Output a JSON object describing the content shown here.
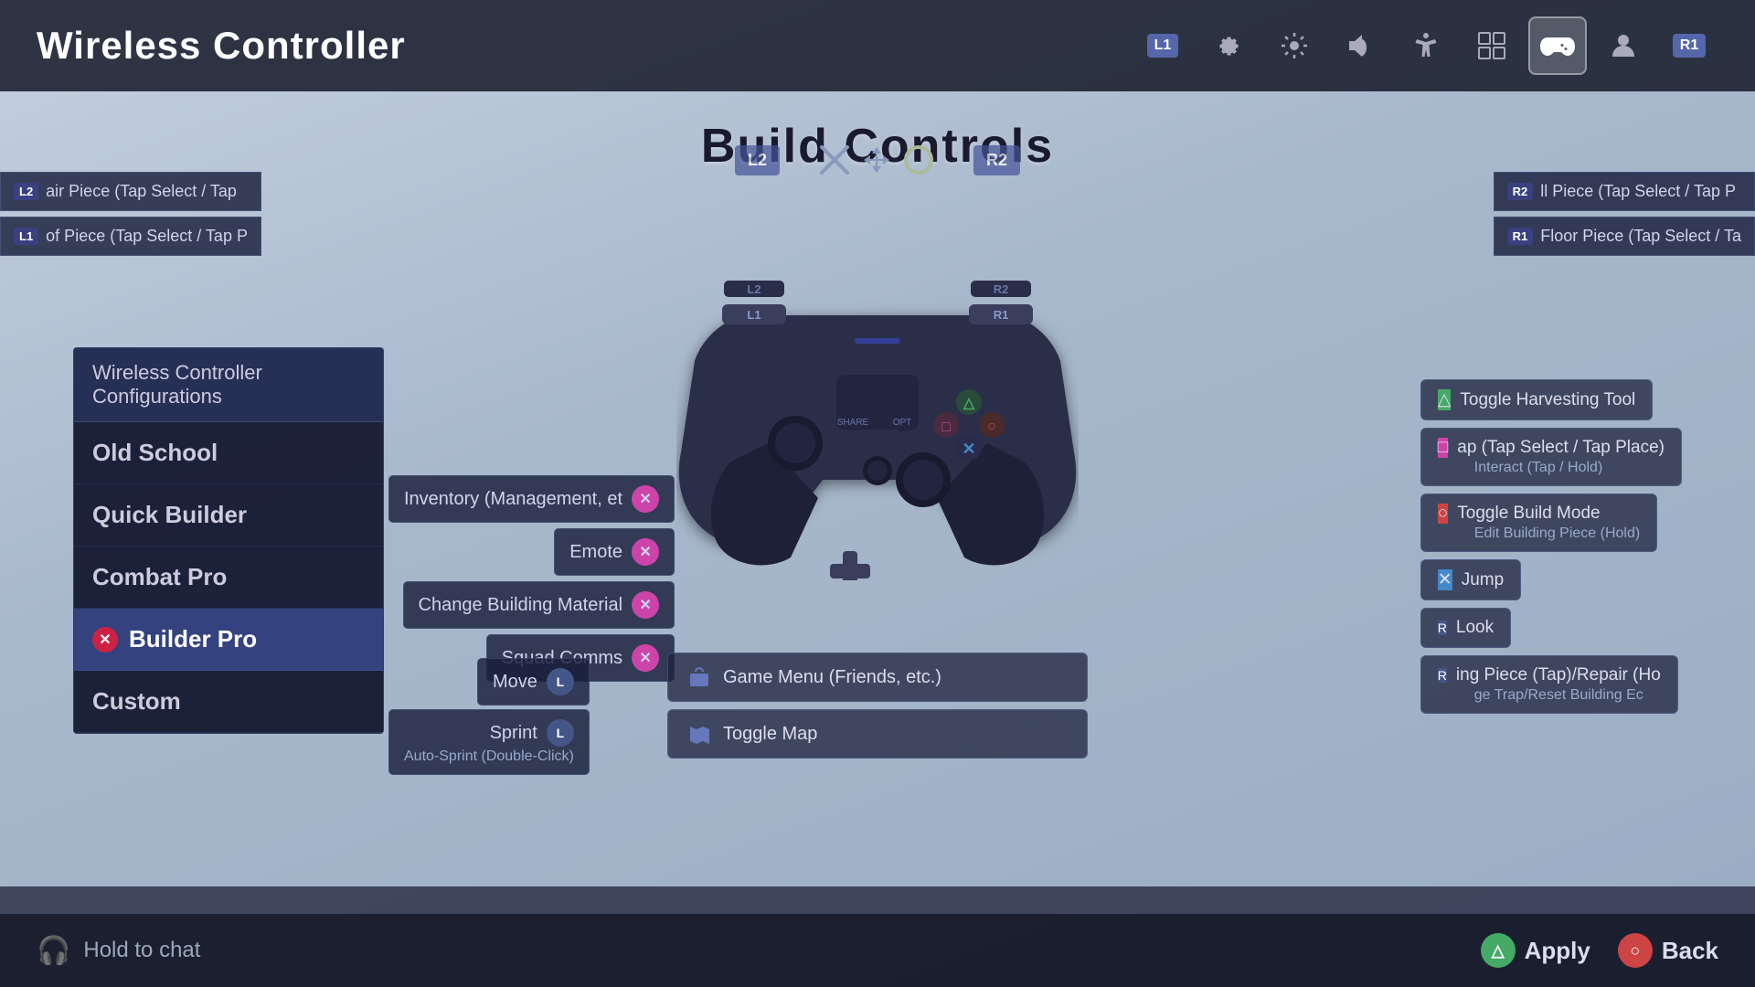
{
  "page": {
    "title": "Wireless Controller",
    "section": "Build Controls"
  },
  "nav": {
    "icons": [
      {
        "name": "l1-tab",
        "label": "L1",
        "symbol": "L1",
        "active": false
      },
      {
        "name": "settings-tab",
        "label": "Settings",
        "symbol": "⚙",
        "active": false
      },
      {
        "name": "brightness-tab",
        "label": "Brightness",
        "symbol": "☀",
        "active": false
      },
      {
        "name": "sound-tab",
        "label": "Sound",
        "symbol": "🔊",
        "active": false
      },
      {
        "name": "accessibility-tab",
        "label": "Accessibility",
        "symbol": "♿",
        "active": false
      },
      {
        "name": "network-tab",
        "label": "Network",
        "symbol": "⊞",
        "active": false
      },
      {
        "name": "controller-tab",
        "label": "Controller",
        "symbol": "🎮",
        "active": true
      },
      {
        "name": "profile-tab",
        "label": "Profile",
        "symbol": "👤",
        "active": false
      },
      {
        "name": "r1-tab",
        "label": "R1",
        "symbol": "R1",
        "active": false
      }
    ]
  },
  "config_panel": {
    "title": "Wireless Controller Configurations",
    "items": [
      {
        "label": "Old School",
        "selected": false
      },
      {
        "label": "Quick Builder",
        "selected": false
      },
      {
        "label": "Combat Pro",
        "selected": false
      },
      {
        "label": "Builder Pro",
        "selected": true,
        "has_x": true
      },
      {
        "label": "Custom",
        "selected": false
      }
    ]
  },
  "left_edge_labels": [
    {
      "text": "air Piece (Tap Select / Tap",
      "badge": "L2"
    },
    {
      "text": "of Piece (Tap Select / Tap P",
      "badge": "L1"
    }
  ],
  "right_edge_labels": [
    {
      "text": "ll Piece (Tap Select / Tap P",
      "badge": "R2"
    },
    {
      "text": "Floor Piece (Tap Select / Ta",
      "badge": "R1"
    }
  ],
  "mid_left_labels": [
    {
      "text": "Inventory (Management, et",
      "icon_type": "sq-btn",
      "icon": "✕"
    },
    {
      "text": "Emote",
      "icon_type": "sq-btn",
      "icon": "✕"
    },
    {
      "text": "Change Building Material",
      "icon_type": "sq-btn",
      "icon": "✕"
    },
    {
      "text": "Squad Comms",
      "icon_type": "sq-btn",
      "icon": "✕"
    }
  ],
  "bottom_left_labels": [
    {
      "text": "Move",
      "icon_type": "l-stick",
      "badge": "L"
    },
    {
      "text": "Sprint",
      "icon_type": "l-stick",
      "badge": "L"
    },
    {
      "sub_text": "Auto-Sprint (Double-Click)"
    }
  ],
  "bottom_center_labels": [
    {
      "text": "Game Menu (Friends, etc.)",
      "icon": "share"
    },
    {
      "text": "Toggle Map",
      "icon": "options"
    }
  ],
  "right_labels": [
    {
      "text": "Toggle Harvesting Tool",
      "icon_type": "tri-btn",
      "icon": "△"
    },
    {
      "text": "ap (Tap Select / Tap Place)",
      "sub_text": "Interact (Tap / Hold)",
      "icon_type": "sq-btn",
      "icon": "□"
    },
    {
      "text": "Toggle Build Mode",
      "sub_text": "Edit Building Piece (Hold)",
      "icon_type": "o-btn",
      "icon": "○"
    },
    {
      "text": "Jump",
      "icon_type": "x-btn",
      "icon": "✕"
    },
    {
      "text": "Look",
      "icon_type": "r-stick",
      "badge": "R"
    },
    {
      "text": "ing Piece (Tap)/Repair (Ho",
      "sub_text": "ge Trap/Reset Building Ec",
      "icon_type": "r-stick",
      "badge": "R"
    }
  ],
  "top_ctrl": {
    "l2": "L2",
    "dpad": "↔",
    "center": "○",
    "r2": "R2"
  },
  "bottom_bar": {
    "hold_to_chat": "Hold to chat",
    "apply_label": "Apply",
    "back_label": "Back"
  }
}
